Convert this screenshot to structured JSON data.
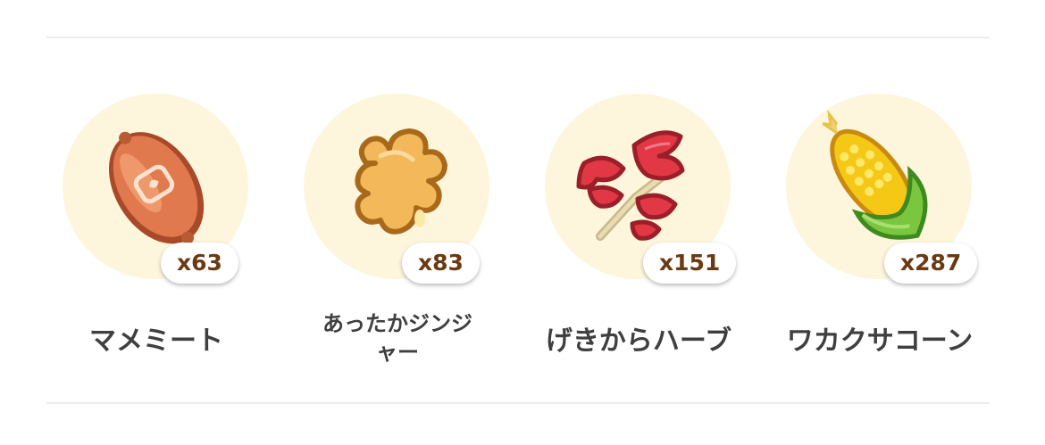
{
  "items": [
    {
      "name": "マメミート",
      "count": "x63",
      "icon": "sausage-icon"
    },
    {
      "name": "あったかジンジャー",
      "count": "x83",
      "icon": "ginger-icon"
    },
    {
      "name": "げきからハーブ",
      "count": "x151",
      "icon": "herb-icon"
    },
    {
      "name": "ワカクサコーン",
      "count": "x287",
      "icon": "corn-icon"
    }
  ],
  "colors": {
    "circle_bg": "#fdf6dc",
    "badge_text": "#6b3a12",
    "name_text": "#3f3f3f",
    "divider": "#ececec"
  }
}
